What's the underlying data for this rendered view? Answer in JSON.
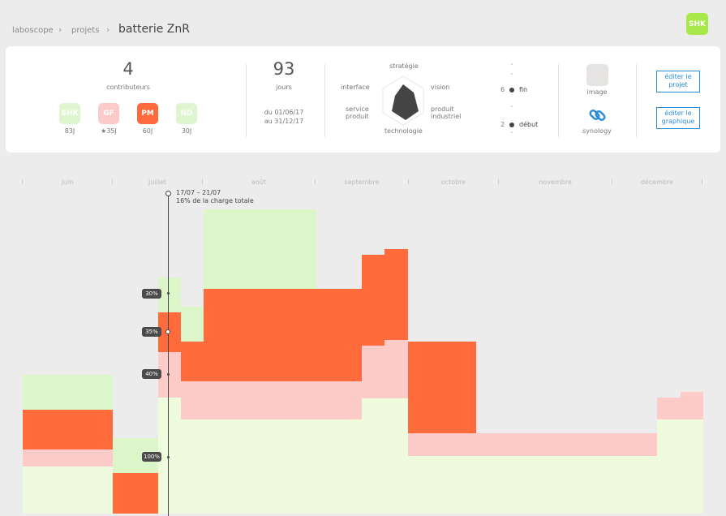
{
  "breadcrumb": {
    "root": "laboscope",
    "section": "projets",
    "current": "batterie ZnR"
  },
  "user_avatar": "SHK",
  "stats": {
    "contributors_count": "4",
    "contributors_label": "contributeurs",
    "days_count": "93",
    "days_label": "jours",
    "date_from": "du 01/06/17",
    "date_to": "au 31/12/17"
  },
  "contributors": [
    {
      "initials": "SHK",
      "days": "83J",
      "color": "#dff5cf"
    },
    {
      "initials": "GF",
      "days": "★35J",
      "color": "#fccbc9"
    },
    {
      "initials": "PM",
      "days": "60J",
      "color": "#ff6b3c"
    },
    {
      "initials": "ND",
      "days": "30J",
      "color": "#dff5cf"
    }
  ],
  "radar": {
    "top": "stratégie",
    "left_top": "interface",
    "right_top": "vision",
    "left_bottom": "service produit",
    "right_bottom": "produit industriel",
    "bottom": "technologie"
  },
  "progress": {
    "end_value": "6",
    "end_label": "fin",
    "start_value": "2",
    "start_label": "début"
  },
  "media": {
    "image_label": "image",
    "synology_label": "synology"
  },
  "actions": {
    "edit_project": "éditer le projet",
    "edit_chart": "éditer le graphique"
  },
  "timeline": {
    "months": [
      "juin",
      "juillet",
      "août",
      "septembre",
      "octobre",
      "novembre",
      "décembre"
    ],
    "cursor_range": "17/07 – 21/07",
    "cursor_note": "16% de la charge totale",
    "percent_markers": [
      "30%",
      "35%",
      "40%",
      "100%"
    ]
  },
  "chart_data": {
    "type": "area",
    "x_unit": "week",
    "series_colors": {
      "SHK": "#eefbdc",
      "SHK_light": "#dcf6c9",
      "GF": "#fdcbc8",
      "PM": "#ff6b3b"
    }
  }
}
